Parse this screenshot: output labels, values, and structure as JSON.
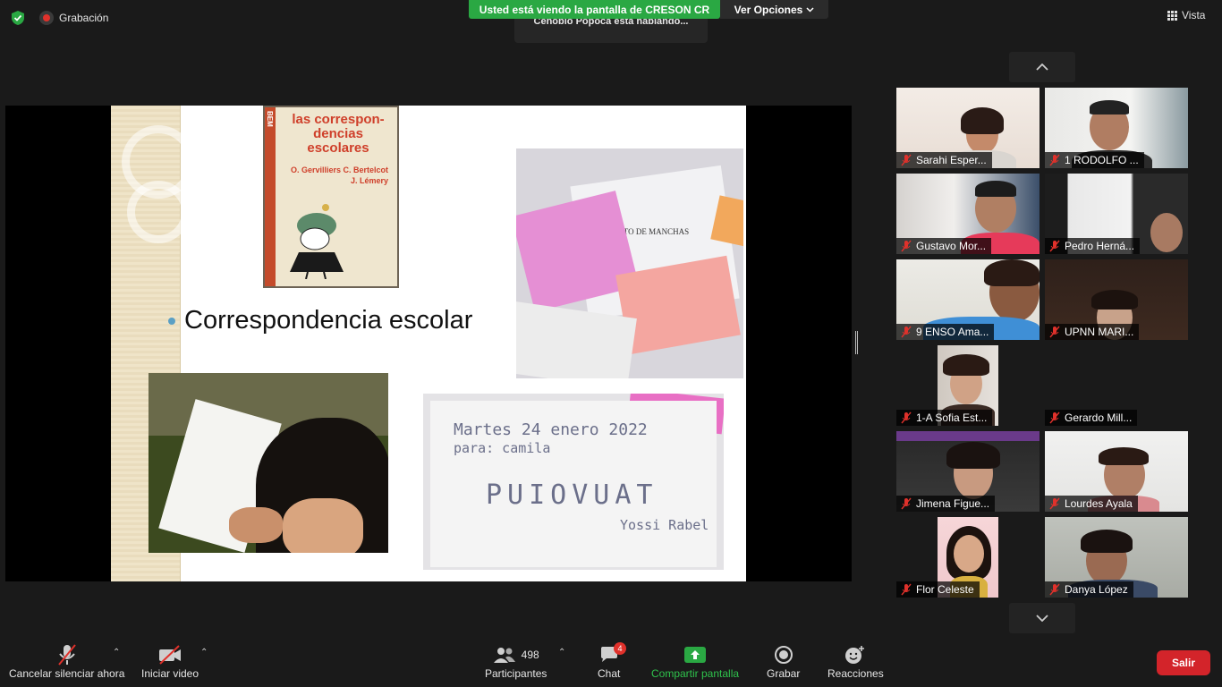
{
  "top": {
    "recording_label": "Grabación",
    "share_banner": "Usted está viendo la pantalla de CRESON CR",
    "view_options": "Ver Opciones",
    "speaking": "Cenobio Popoca está hablando...",
    "view_label": "Vista"
  },
  "slide": {
    "book_title": "las correspon- dencias escolares",
    "book_authors": "O. Gervilliers C. Bertelcot J. Lémery",
    "book_spine": "BEM",
    "bullet_text": "Correspondencia escolar",
    "letters_title": "UN CUENTO DE MANCHAS",
    "note_line1": "Martes 24 enero 2022",
    "note_line2": "para: camila",
    "note_big": "PUIOVUAT",
    "note_sig": "Yossi Rabel"
  },
  "participants": [
    {
      "name": "Sarahi Esper..."
    },
    {
      "name": "1 RODOLFO ..."
    },
    {
      "name": "Gustavo Mor..."
    },
    {
      "name": "Pedro Herná..."
    },
    {
      "name": "9 ENSO Ama..."
    },
    {
      "name": "UPNN MARI..."
    },
    {
      "name": "1-A Sofia Est..."
    },
    {
      "name": "Gerardo Mill..."
    },
    {
      "name": "Jimena Figue..."
    },
    {
      "name": "Lourdes Ayala"
    },
    {
      "name": "Flor Celeste"
    },
    {
      "name": "Danya López"
    }
  ],
  "toolbar": {
    "mute_label": "Cancelar silenciar ahora",
    "video_label": "Iniciar video",
    "participants_label": "Participantes",
    "participants_count": "498",
    "chat_label": "Chat",
    "chat_badge": "4",
    "share_label": "Compartir pantalla",
    "record_label": "Grabar",
    "reactions_label": "Reacciones",
    "leave_label": "Salir"
  },
  "colors": {
    "share_green": "#2aa843",
    "leave_red": "#d3242a",
    "mic_off_red": "#e0312b"
  }
}
